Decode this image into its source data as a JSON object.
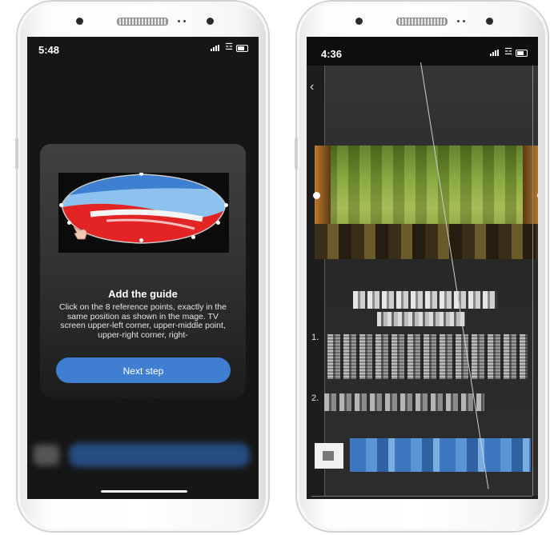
{
  "left_phone": {
    "status": {
      "time": "5:48"
    },
    "modal": {
      "title": "Add the guide",
      "description": "Click on the 8 reference points, exactly in the same position as shown in the mage. TV screen upper-left corner, upper-middle point, upper-right corner, right-",
      "button_label": "Next step"
    }
  },
  "right_phone": {
    "status": {
      "time": "4:36"
    },
    "list_markers": [
      "1.",
      "2."
    ]
  },
  "colors": {
    "accent": "#3f7ed0",
    "screen_bg": "#161616",
    "modal_bg": "#333333"
  },
  "icons": [
    "signal-icon",
    "wifi-icon",
    "battery-icon",
    "hand-pointer-icon",
    "back-chevron-icon"
  ]
}
